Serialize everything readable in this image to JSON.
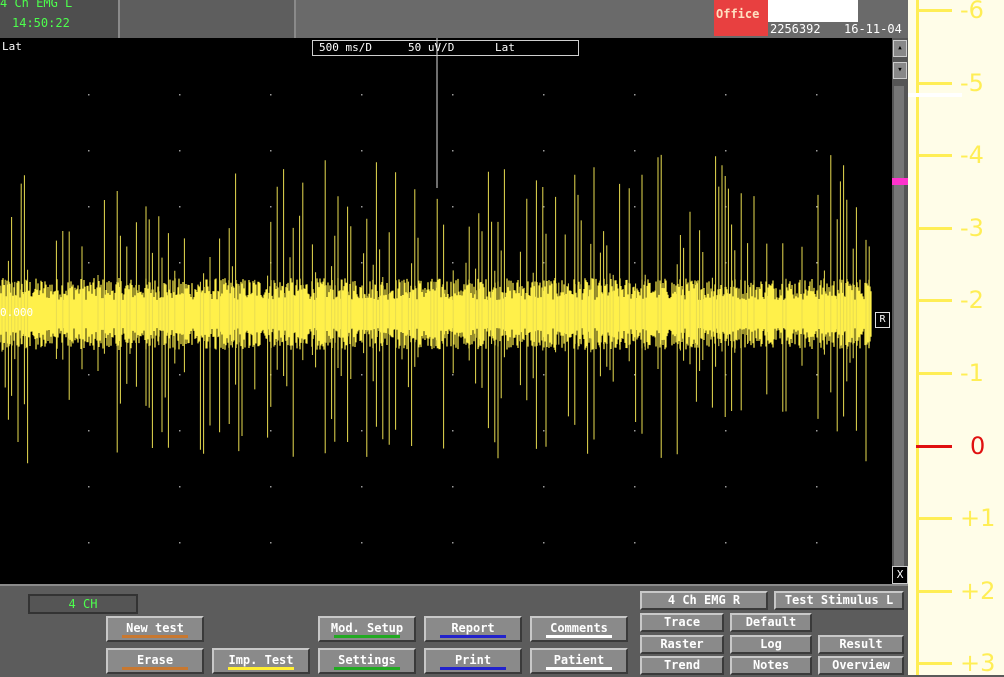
{
  "header": {
    "channel_title": "4 Ch EMG L",
    "time": "14:50:22",
    "office_label": "Office",
    "patient_id": "2256392",
    "date": "16-11-04"
  },
  "trace": {
    "lat_label": "Lat",
    "sweep": "500 ms/D",
    "gain": "50 uV/D",
    "lat_box_label": "Lat",
    "baseline_value": "0.000",
    "marker_label": "R",
    "close_label": "X"
  },
  "ruler": {
    "labels": [
      "-6",
      "-5",
      "-4",
      "-3",
      "-2",
      "-1",
      "0",
      "+1",
      "+2",
      "+3"
    ],
    "zero_color": "#e01010",
    "tick_color": "#ffee55"
  },
  "bottom": {
    "channel_count": "4 CH",
    "buttons": {
      "new_test": "New test",
      "erase": "Erase",
      "imp_test": "Imp. Test",
      "mod_setup": "Mod. Setup",
      "settings": "Settings",
      "report": "Report",
      "print": "Print",
      "comments": "Comments",
      "patient": "Patient",
      "emg_r": "4 Ch EMG R",
      "test_stimulus": "Test Stimulus L",
      "trace": "Trace",
      "default": "Default",
      "raster": "Raster",
      "log": "Log",
      "result": "Result",
      "trend": "Trend",
      "notes": "Notes",
      "overview": "Overview"
    },
    "underline_colors": {
      "new_test": "#c87830",
      "erase": "#c87830",
      "imp_test": "#ffee33",
      "mod_setup": "#22aa22",
      "settings": "#22aa22",
      "report": "#2222cc",
      "print": "#2222cc",
      "comments": "#ffffff",
      "patient": "#ffffff"
    }
  }
}
